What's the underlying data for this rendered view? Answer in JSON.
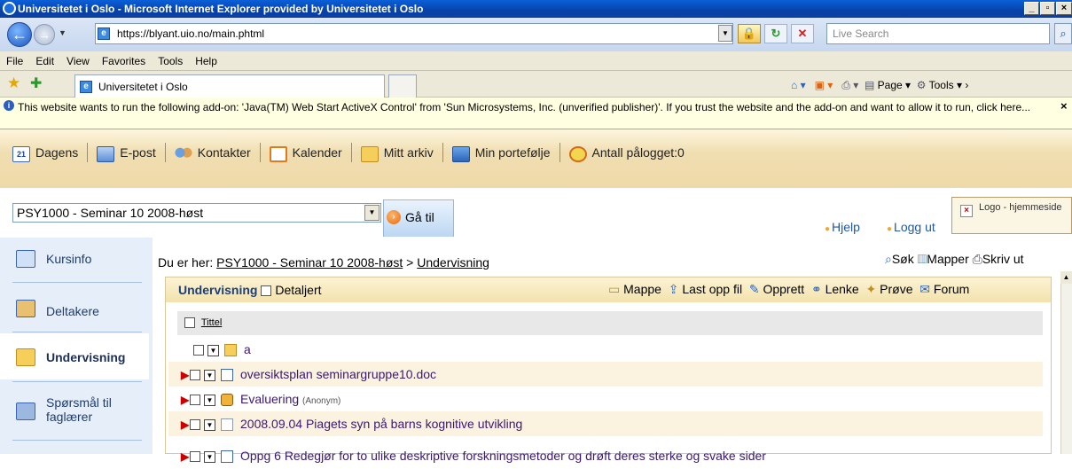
{
  "window": {
    "title": "Universitetet i Oslo - Microsoft Internet Explorer provided by Universitetet i Oslo"
  },
  "address": {
    "url": "https://blyant.uio.no/main.phtml",
    "search_placeholder": "Live Search"
  },
  "menu": [
    "File",
    "Edit",
    "View",
    "Favorites",
    "Tools",
    "Help"
  ],
  "tab": {
    "title": "Universitetet i Oslo"
  },
  "commandbar": {
    "page": "Page",
    "tools": "Tools"
  },
  "infobar": {
    "text": "This website wants to run the following add-on: 'Java(TM) Web Start ActiveX Control' from 'Sun Microsystems, Inc. (unverified publisher)'. If you trust the website and the add-on and want to allow it to run, click here..."
  },
  "topnav": {
    "dagens": "Dagens",
    "dagens_num": "21",
    "epost": "E-post",
    "kontakter": "Kontakter",
    "kalender": "Kalender",
    "mitt_arkiv": "Mitt arkiv",
    "portefolje": "Min portefølje",
    "online": "Antall pålogget:0"
  },
  "course": {
    "selected": "PSY1000 - Seminar 10  2008-høst",
    "go": "Gå til"
  },
  "links": {
    "hjelp": "Hjelp",
    "logg_ut": "Logg ut",
    "logo_alt": "Logo - hjemmeside"
  },
  "sidebar": {
    "items": [
      {
        "label": "Kursinfo"
      },
      {
        "label": "Deltakere"
      },
      {
        "label": "Undervisning"
      },
      {
        "label": "Spørsmål til faglærer"
      }
    ]
  },
  "breadcrumb": {
    "prefix": "Du er her:",
    "course": "PSY1000 - Seminar 10 2008-høst",
    "sep": ">",
    "current": "Undervisning"
  },
  "tools": {
    "sok": "Søk",
    "mapper": "Mapper",
    "skriv": "Skriv ut"
  },
  "panel": {
    "title": "Undervisning",
    "detaljert": "Detaljert",
    "mappe": "Mappe",
    "last_opp": "Last opp fil",
    "opprett": "Opprett",
    "lenke": "Lenke",
    "prove": "Prøve",
    "forum": "Forum"
  },
  "table": {
    "col_title": "Tittel",
    "rows": [
      {
        "title": "a",
        "note": ""
      },
      {
        "title": "oversiktsplan seminargruppe10.doc",
        "note": ""
      },
      {
        "title": "Evaluering",
        "note": "(Anonym)"
      },
      {
        "title": "2008.09.04 Piagets syn på barns kognitive utvikling",
        "note": ""
      },
      {
        "title": "Oppg 6 Redegjør for to ulike deskriptive forskningsmetoder og drøft deres sterke og svake sider",
        "note": ""
      }
    ]
  }
}
